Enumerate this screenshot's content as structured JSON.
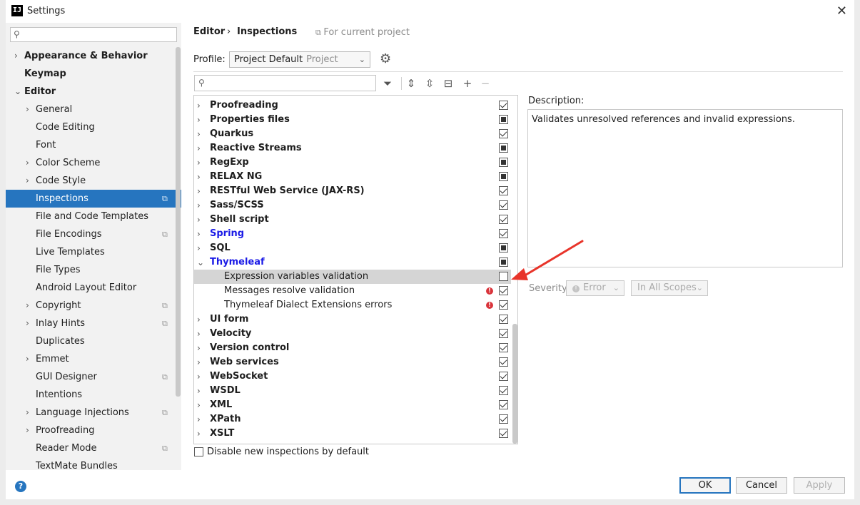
{
  "window": {
    "title": "Settings",
    "app_icon": "IJ"
  },
  "sidebar": {
    "items": [
      {
        "label": "Appearance & Behavior",
        "level": 0,
        "arrow": "›",
        "bold": true
      },
      {
        "label": "Keymap",
        "level": 0,
        "arrow": "",
        "bold": true
      },
      {
        "label": "Editor",
        "level": 0,
        "arrow": "⌄",
        "bold": true
      },
      {
        "label": "General",
        "level": 1,
        "arrow": "›"
      },
      {
        "label": "Code Editing",
        "level": 1,
        "arrow": ""
      },
      {
        "label": "Font",
        "level": 1,
        "arrow": ""
      },
      {
        "label": "Color Scheme",
        "level": 1,
        "arrow": "›"
      },
      {
        "label": "Code Style",
        "level": 1,
        "arrow": "›"
      },
      {
        "label": "Inspections",
        "level": 1,
        "arrow": "",
        "selected": true,
        "scope": true
      },
      {
        "label": "File and Code Templates",
        "level": 1,
        "arrow": ""
      },
      {
        "label": "File Encodings",
        "level": 1,
        "arrow": "",
        "scope": true
      },
      {
        "label": "Live Templates",
        "level": 1,
        "arrow": ""
      },
      {
        "label": "File Types",
        "level": 1,
        "arrow": ""
      },
      {
        "label": "Android Layout Editor",
        "level": 1,
        "arrow": ""
      },
      {
        "label": "Copyright",
        "level": 1,
        "arrow": "›",
        "scope": true
      },
      {
        "label": "Inlay Hints",
        "level": 1,
        "arrow": "›",
        "scope": true
      },
      {
        "label": "Duplicates",
        "level": 1,
        "arrow": ""
      },
      {
        "label": "Emmet",
        "level": 1,
        "arrow": "›"
      },
      {
        "label": "GUI Designer",
        "level": 1,
        "arrow": "",
        "scope": true
      },
      {
        "label": "Intentions",
        "level": 1,
        "arrow": ""
      },
      {
        "label": "Language Injections",
        "level": 1,
        "arrow": "›",
        "scope": true
      },
      {
        "label": "Proofreading",
        "level": 1,
        "arrow": "›"
      },
      {
        "label": "Reader Mode",
        "level": 1,
        "arrow": "",
        "scope": true
      },
      {
        "label": "TextMate Bundles",
        "level": 1,
        "arrow": ""
      }
    ]
  },
  "breadcrumb": {
    "first": "Editor",
    "separator": "›",
    "second": "Inspections",
    "note": "For current project"
  },
  "profile": {
    "label": "Profile:",
    "value": "Project Default",
    "secondary": "Project"
  },
  "tree": {
    "rows": [
      {
        "label": "Proofreading",
        "type": "group",
        "state": "checked",
        "arrow": "›"
      },
      {
        "label": "Properties files",
        "type": "group",
        "state": "mixed",
        "arrow": "›"
      },
      {
        "label": "Quarkus",
        "type": "group",
        "state": "checked",
        "arrow": "›"
      },
      {
        "label": "Reactive Streams",
        "type": "group",
        "state": "mixed",
        "arrow": "›"
      },
      {
        "label": "RegExp",
        "type": "group",
        "state": "mixed",
        "arrow": "›"
      },
      {
        "label": "RELAX NG",
        "type": "group",
        "state": "mixed",
        "arrow": "›"
      },
      {
        "label": "RESTful Web Service (JAX-RS)",
        "type": "group",
        "state": "checked",
        "arrow": "›"
      },
      {
        "label": "Sass/SCSS",
        "type": "group",
        "state": "checked",
        "arrow": "›"
      },
      {
        "label": "Shell script",
        "type": "group",
        "state": "checked",
        "arrow": "›"
      },
      {
        "label": "Spring",
        "type": "group",
        "state": "checked",
        "arrow": "›",
        "blue": true
      },
      {
        "label": "SQL",
        "type": "group",
        "state": "mixed",
        "arrow": "›"
      },
      {
        "label": "Thymeleaf",
        "type": "group",
        "state": "mixed",
        "arrow": "⌄",
        "blue": true
      },
      {
        "label": "Expression variables validation",
        "type": "child",
        "state": "unchecked",
        "highlight": true
      },
      {
        "label": "Messages resolve validation",
        "type": "child",
        "state": "checked",
        "error": true
      },
      {
        "label": "Thymeleaf Dialect Extensions errors",
        "type": "child",
        "state": "checked",
        "error": true
      },
      {
        "label": "UI form",
        "type": "group",
        "state": "checked",
        "arrow": "›"
      },
      {
        "label": "Velocity",
        "type": "group",
        "state": "checked",
        "arrow": "›"
      },
      {
        "label": "Version control",
        "type": "group",
        "state": "checked",
        "arrow": "›"
      },
      {
        "label": "Web services",
        "type": "group",
        "state": "checked",
        "arrow": "›"
      },
      {
        "label": "WebSocket",
        "type": "group",
        "state": "checked",
        "arrow": "›"
      },
      {
        "label": "WSDL",
        "type": "group",
        "state": "checked",
        "arrow": "›"
      },
      {
        "label": "XML",
        "type": "group",
        "state": "checked",
        "arrow": "›"
      },
      {
        "label": "XPath",
        "type": "group",
        "state": "checked",
        "arrow": "›"
      },
      {
        "label": "XSLT",
        "type": "group",
        "state": "checked",
        "arrow": "›"
      }
    ]
  },
  "disable_new": {
    "label": "Disable new inspections by default",
    "checked": false
  },
  "description": {
    "label": "Description:",
    "text": "Validates unresolved references and invalid expressions."
  },
  "severity": {
    "label": "Severity:",
    "level": "Error",
    "scope": "In All Scopes"
  },
  "buttons": {
    "ok": "OK",
    "cancel": "Cancel",
    "apply": "Apply"
  },
  "colors": {
    "selection": "#2675bf",
    "link_blue": "#1a1ae6",
    "error_red": "#d9343b",
    "annotation_arrow": "#e8342a"
  },
  "icons": {
    "help": "?",
    "gear": "⚙",
    "close": "✕"
  }
}
